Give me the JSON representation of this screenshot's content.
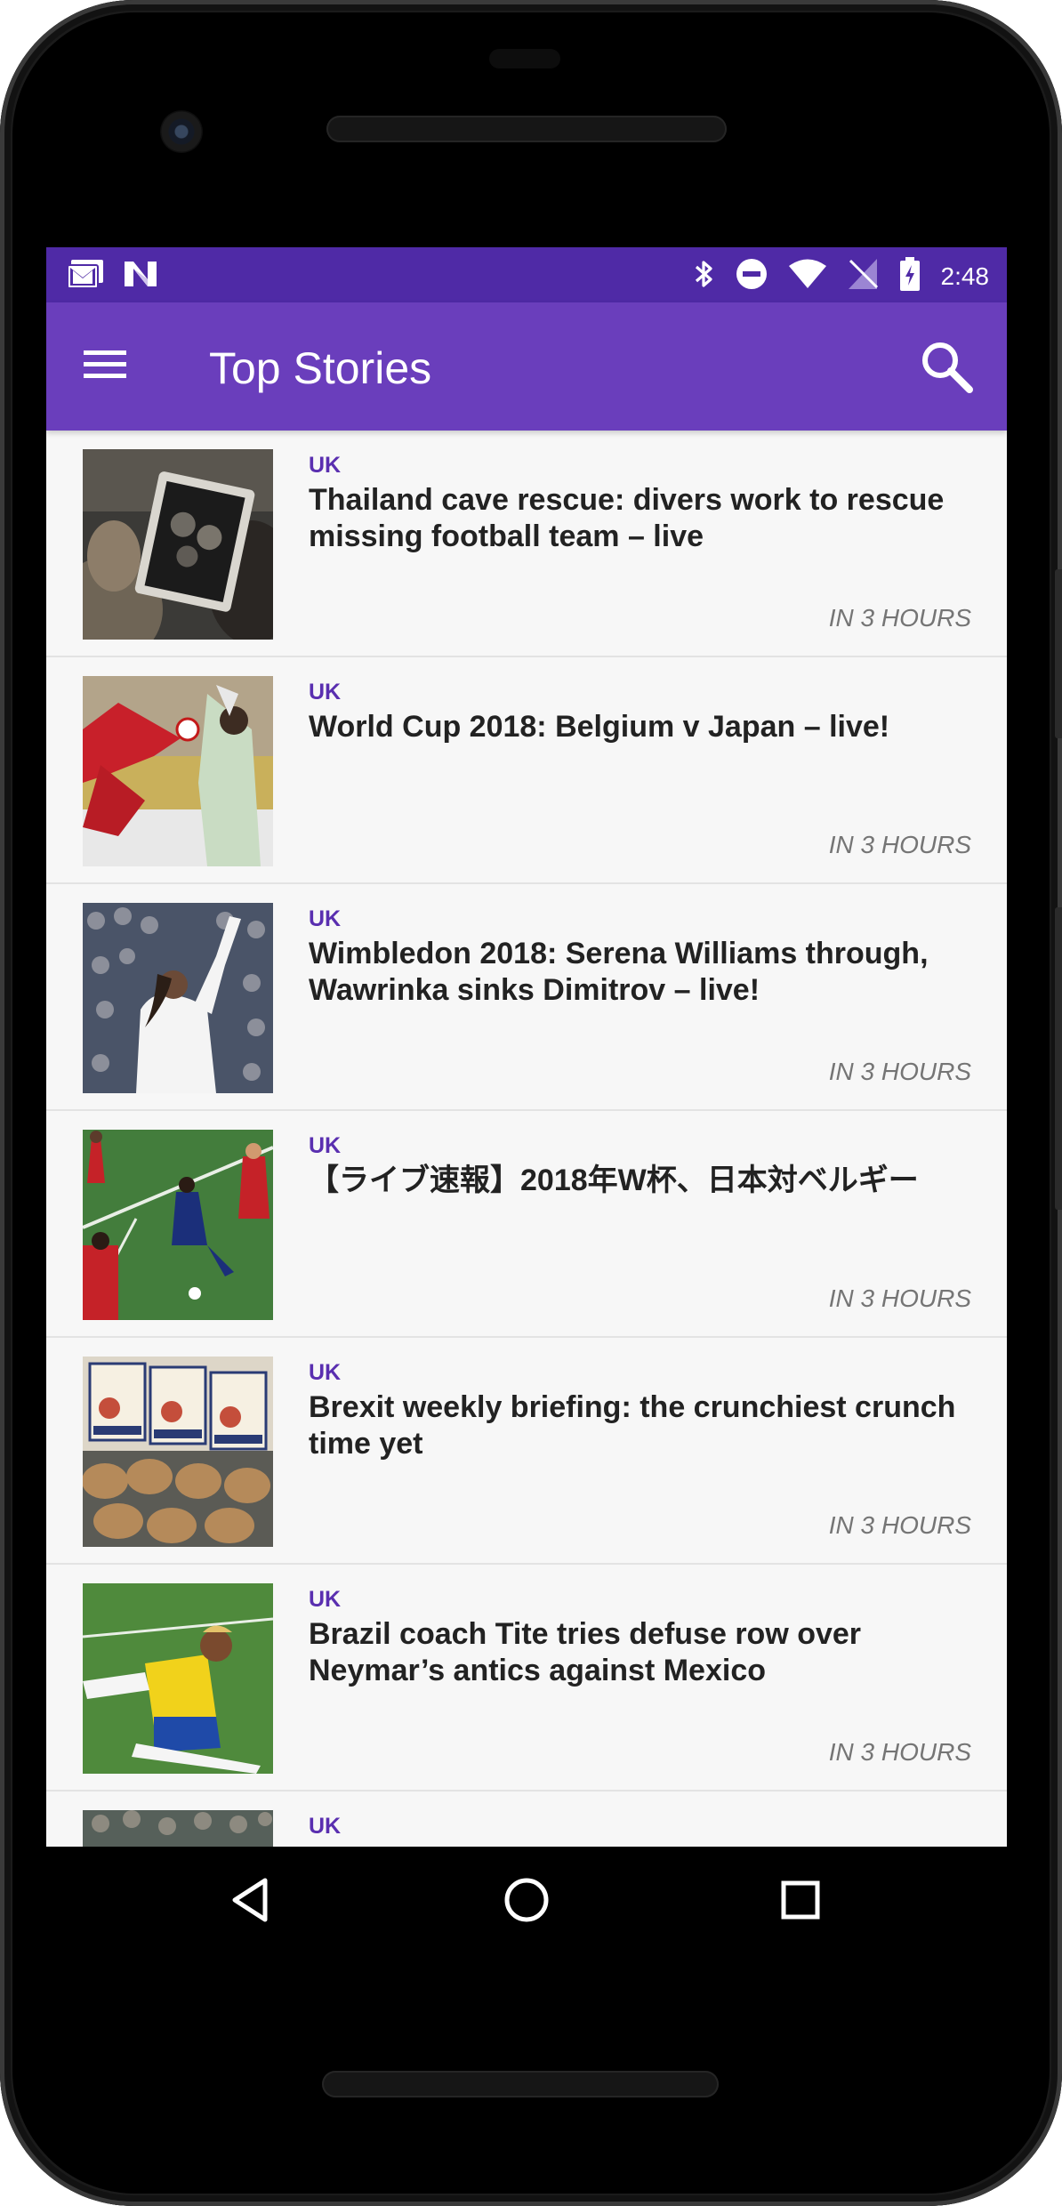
{
  "status_bar": {
    "time": "2:48",
    "left_icons": [
      "gmail-icon",
      "n-logo-icon"
    ],
    "right_icons": [
      "bluetooth-icon",
      "do-not-disturb-icon",
      "wifi-icon",
      "no-sim-icon",
      "battery-charging-icon"
    ]
  },
  "app_bar": {
    "title": "Top Stories",
    "menu_icon": "hamburger-menu-icon",
    "search_icon": "search-icon",
    "color": "#6a3ebc",
    "status_color": "#4f2aa6"
  },
  "articles": [
    {
      "section": "UK",
      "headline": "Thailand cave rescue: divers work to rescue missing football team – live",
      "time": "IN 3 HOURS"
    },
    {
      "section": "UK",
      "headline": "World Cup 2018: Belgium v Japan – live!",
      "time": "IN 3 HOURS"
    },
    {
      "section": "UK",
      "headline": "Wimbledon 2018: Serena Williams through, Wawrinka sinks Dimitrov – live!",
      "time": "IN 3 HOURS"
    },
    {
      "section": "UK",
      "headline": "【ライブ速報】2018年W杯、日本対ベルギー",
      "time": "IN 3 HOURS"
    },
    {
      "section": "UK",
      "headline": "Brexit weekly briefing: the crunchiest crunch time yet",
      "time": "IN 3 HOURS"
    },
    {
      "section": "UK",
      "headline": "Brazil coach Tite tries defuse row over Neymar’s antics against Mexico",
      "time": "IN 3 HOURS"
    },
    {
      "section": "UK",
      "headline": "",
      "time": ""
    }
  ],
  "nav_bar": {
    "icons": [
      "back-icon",
      "home-icon",
      "recents-icon"
    ]
  }
}
